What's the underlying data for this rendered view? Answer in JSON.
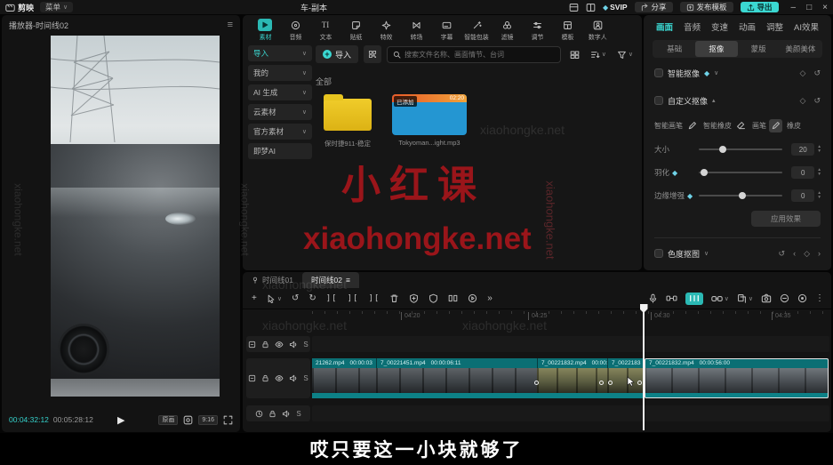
{
  "titlebar": {
    "app_name": "剪映",
    "menu": "菜单",
    "doc_title": "车-副本",
    "svip": "SVIP",
    "share": "分享",
    "publish": "发布模板",
    "export": "导出",
    "window": {
      "minimize": "–",
      "maximize": "□",
      "close": "×"
    }
  },
  "player": {
    "header": "播放器-时间线02",
    "current_time": "00:04:32:12",
    "total_time": "00:05:28:12",
    "quality": "原画",
    "ratio": "9:16"
  },
  "media": {
    "tabs": [
      {
        "label": "素材",
        "active": true
      },
      {
        "label": "音频"
      },
      {
        "label": "文本"
      },
      {
        "label": "贴纸"
      },
      {
        "label": "特效"
      },
      {
        "label": "转场"
      },
      {
        "label": "字幕"
      },
      {
        "label": "智能包装"
      },
      {
        "label": "滤镜"
      },
      {
        "label": "调节"
      },
      {
        "label": "模板"
      },
      {
        "label": "数字人"
      }
    ],
    "sidebar": [
      {
        "label": "导入",
        "active": true
      },
      {
        "label": "我的"
      },
      {
        "label": "AI 生成"
      },
      {
        "label": "云素材"
      },
      {
        "label": "官方素材"
      },
      {
        "label": "即梦AI"
      }
    ],
    "import_button": "导入",
    "search_placeholder": "搜索文件名称、画面情节、台词",
    "section_all": "全部",
    "items": {
      "folder": {
        "name": "保时捷911-稳定"
      },
      "audio": {
        "name": "Tokyoman...ight.mp3",
        "badge": "已添加",
        "duration": "02:20"
      }
    }
  },
  "inspector": {
    "tabs": [
      {
        "label": "画面",
        "active": true
      },
      {
        "label": "音频"
      },
      {
        "label": "变速"
      },
      {
        "label": "动画"
      },
      {
        "label": "调整"
      },
      {
        "label": "AI效果"
      }
    ],
    "subtabs": [
      {
        "label": "基础"
      },
      {
        "label": "抠像",
        "active": true
      },
      {
        "label": "蒙版"
      },
      {
        "label": "美颜美体"
      }
    ],
    "smart_keying": {
      "label": "智能抠像"
    },
    "custom_keying": {
      "label": "自定义抠像"
    },
    "tools": [
      {
        "label": "智能画笔"
      },
      {
        "label": "智能橡皮"
      },
      {
        "label": "画笔",
        "active": true
      },
      {
        "label": "橡皮"
      }
    ],
    "sliders": [
      {
        "label": "大小",
        "value": "20"
      },
      {
        "label": "羽化",
        "value": "0",
        "vip": true
      },
      {
        "label": "边缘增强",
        "value": "0",
        "vip": true
      }
    ],
    "apply": "应用效果",
    "chroma": {
      "label": "色度抠图"
    }
  },
  "timeline": {
    "tabs": [
      {
        "label": "时间线01"
      },
      {
        "label": "时间线02",
        "active": true
      }
    ],
    "ruler": [
      "04:20",
      "04:25",
      "04:30",
      "04:35"
    ],
    "clips": [
      {
        "name": "21262.mp4",
        "duration": "00:00:03"
      },
      {
        "name": "7_00221451.mp4",
        "duration": "00:00:06:11"
      },
      {
        "name": "7_00221832.mp4",
        "duration": "00:00:"
      },
      {
        "name": "7_0022183",
        "duration": ""
      },
      {
        "name": "7_00221832.mp4",
        "duration": "00:00:56:00"
      }
    ],
    "track_mute_label": "S"
  },
  "watermarks": {
    "title": "小红课",
    "url": "xiaohongke.net"
  },
  "subtitle": "哎只要这一小块就够了",
  "icons": {
    "hamburger": "≡",
    "chevron-down": "∨",
    "chevron-up": "▴",
    "undo": "↺",
    "redo": "↻",
    "more-chevrons": "»",
    "split-brackets": "][",
    "vip-diamond": "◆",
    "keyframe-diamond": "◇",
    "keyframe-prev": "‹",
    "keyframe-next": "›",
    "stepper-up": "▴",
    "stepper-down": "▾",
    "play": "▶",
    "more-dots": "⋮",
    "plus": "+"
  },
  "colors": {
    "accent": "#3bd8d2",
    "clip_teal": "#0b6f74",
    "watermark_red": "#a6151b",
    "audio_tile_blue": "#2496d2",
    "folder_yellow": "#e7c41f"
  }
}
